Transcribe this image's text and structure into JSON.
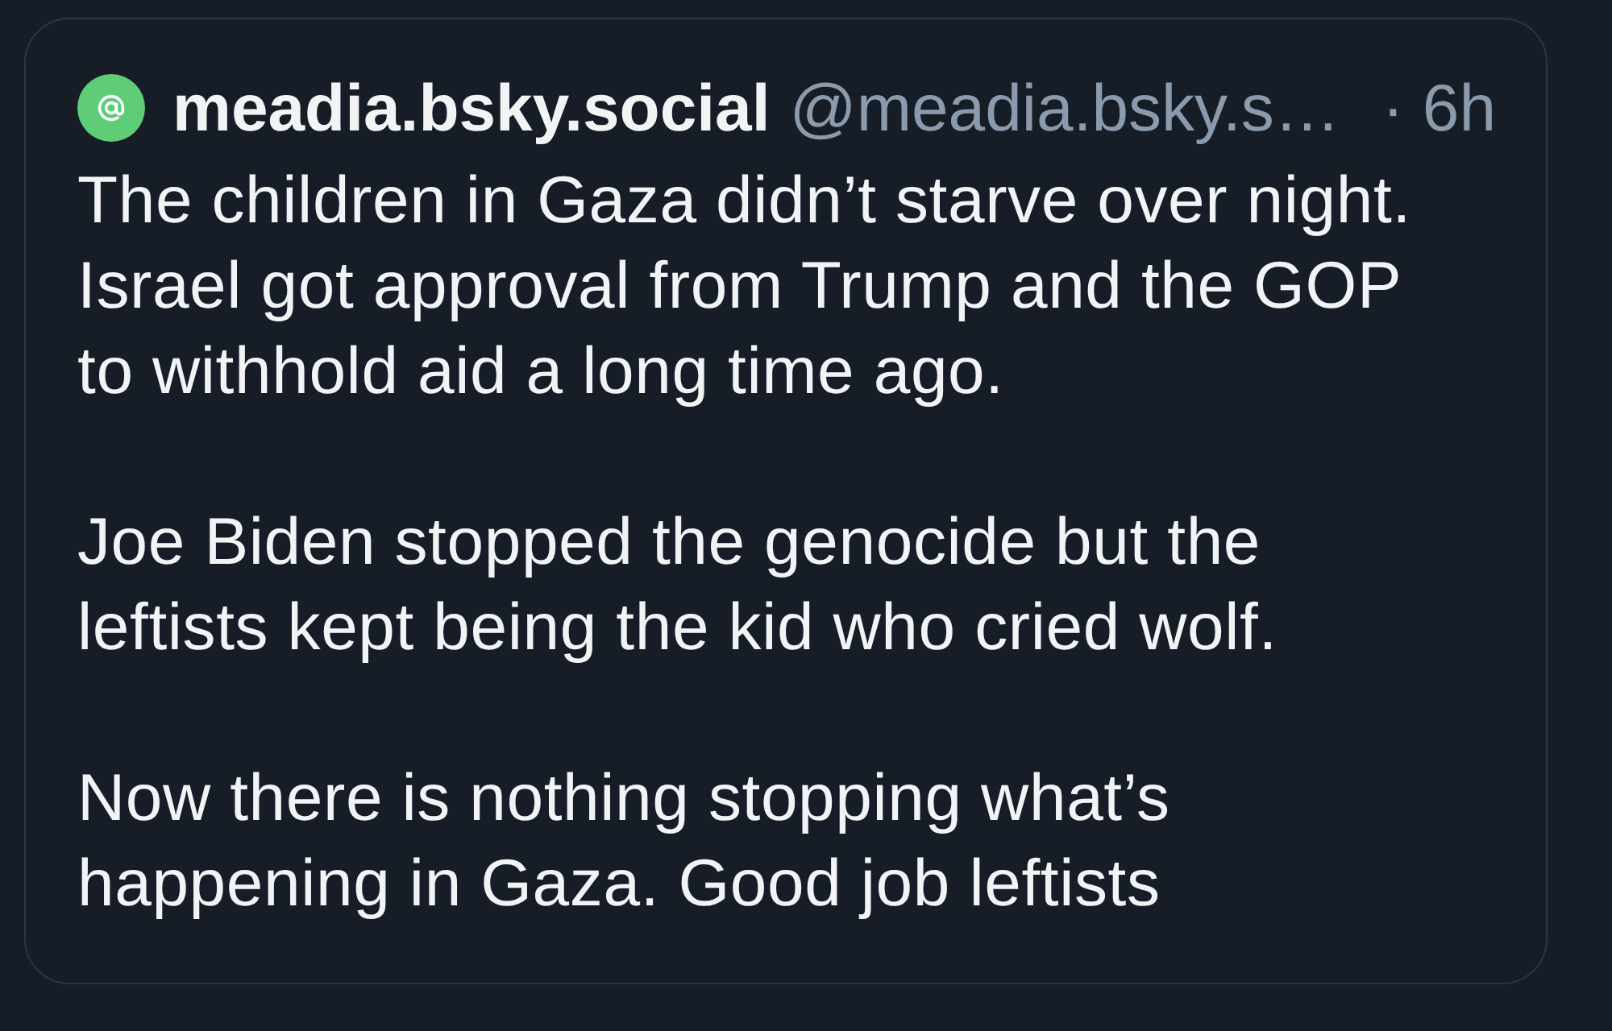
{
  "post": {
    "author": {
      "display_name": "meadia.bsky.social",
      "handle": "@meadia.bsky.s…"
    },
    "time": "· 6h",
    "paragraphs": [
      "The children in Gaza didn’t starve over night. Israel got approval from Trump and the GOP to withhold aid a long time ago.",
      "Joe Biden stopped the genocide but the leftists kept being the kid who cried wolf.",
      "Now there is nothing stopping what’s happening in Gaza. Good job leftists"
    ]
  }
}
